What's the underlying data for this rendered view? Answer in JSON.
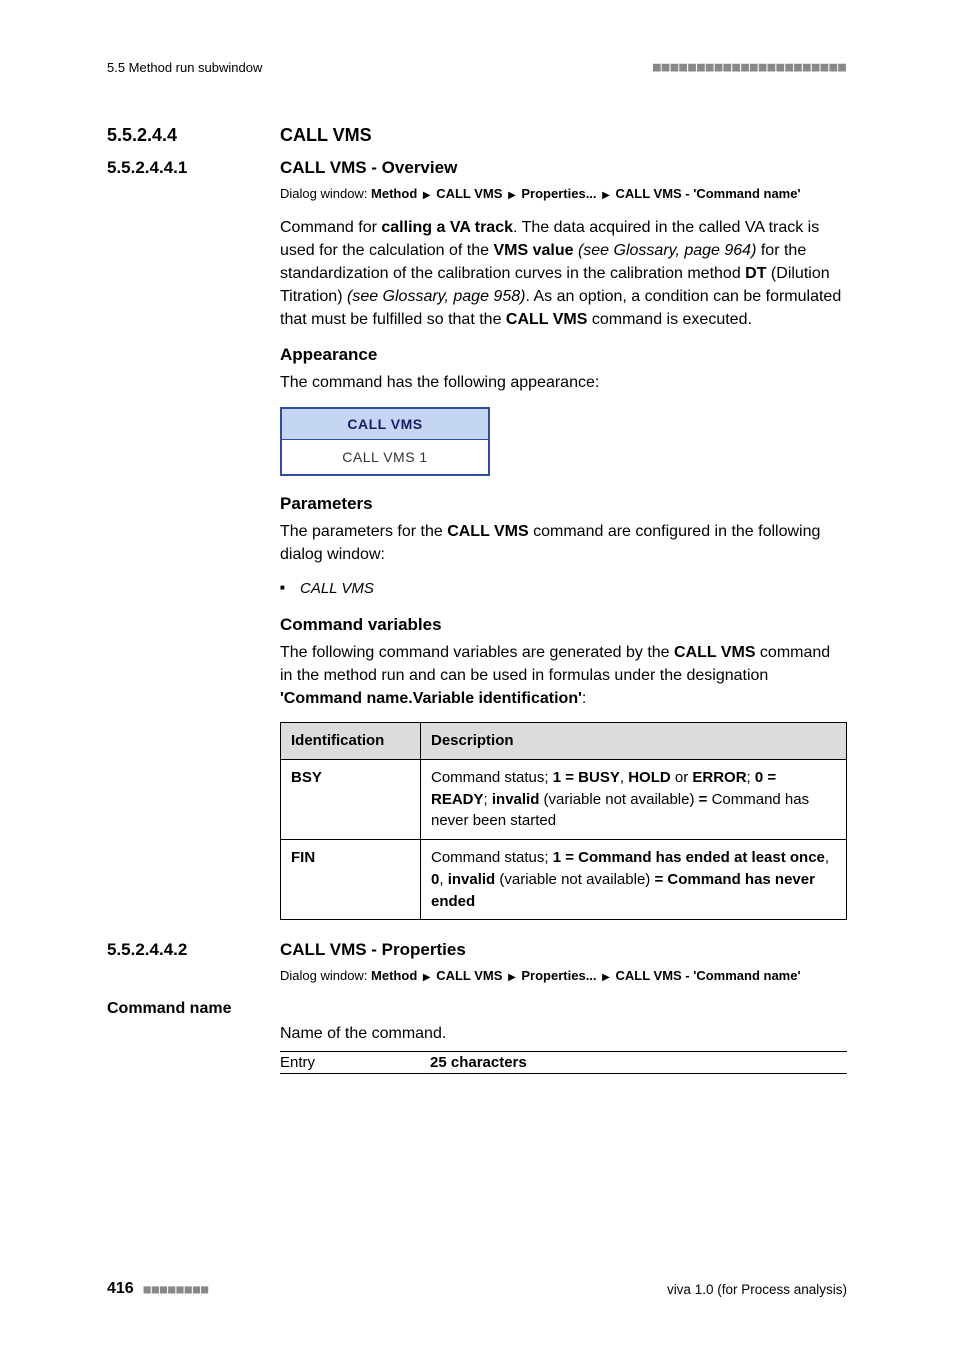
{
  "header": {
    "running_title": "5.5 Method run subwindow",
    "deco": "■■■■■■■■■■■■■■■■■■■■■■"
  },
  "sections": {
    "s0": {
      "num": "5.5.2.4.4",
      "title": "CALL VMS"
    },
    "s1": {
      "num": "5.5.2.4.4.1",
      "title": "CALL VMS - Overview",
      "dialog_label": "Dialog window: ",
      "dialog_parts": [
        "Method",
        "CALL VMS",
        "Properties...",
        "CALL VMS - 'Command name'"
      ],
      "para1_pre": "Command for ",
      "para1_b1": "calling a VA track",
      "para1_mid1": ". The data acquired in the called VA track is used for the calculation of the ",
      "para1_b2": "VMS value",
      "para1_i1": " (see Glossary, page 964)",
      "para1_mid2": " for the standardization of the calibration curves in the calibration method ",
      "para1_b3": "DT",
      "para1_mid3": " (Dilution Titration) ",
      "para1_i2": "(see Glossary, page 958)",
      "para1_mid4": ". As an option, a condition can be formulated that must be fulfilled so that the ",
      "para1_b4": "CALL VMS",
      "para1_end": " command is executed.",
      "appearance_head": "Appearance",
      "appearance_text": "The command has the following appearance:",
      "callvms_head": "CALL VMS",
      "callvms_body": "CALL VMS 1",
      "params_head": "Parameters",
      "params_pre": "The parameters for the ",
      "params_b": "CALL VMS",
      "params_post": " command are configured in the following dialog window:",
      "params_items": [
        "CALL VMS"
      ],
      "cmdvar_head": "Command variables",
      "cmdvar_pre": "The following command variables are generated by the ",
      "cmdvar_b": "CALL VMS",
      "cmdvar_mid": " command in the method run and can be used in formulas under the designation ",
      "cmdvar_b2": "'Command name.Variable identification'",
      "cmdvar_end": ":"
    },
    "table": {
      "col1": "Identification",
      "col2": "Description",
      "rows": [
        {
          "id": "BSY",
          "d_pre": "Command status; ",
          "d_b1": "1 = BUSY",
          "d_m1": ", ",
          "d_b2": "HOLD",
          "d_m2": " or ",
          "d_b3": "ERROR",
          "d_m3": "; ",
          "d_b4": "0 = READY",
          "d_m4": "; ",
          "d_b5": "invalid",
          "d_m5": " (variable not available) ",
          "d_b6": "=",
          "d_m6": " Command has never been started"
        },
        {
          "id": "FIN",
          "d_pre": "Command status; ",
          "d_b1": "1 = Command has ended at least once",
          "d_m1": ", ",
          "d_b2": "0",
          "d_m2": ", ",
          "d_b3": "invalid",
          "d_m3": " (variable not available) ",
          "d_b4": "= Command has never ended",
          "d_m4": "",
          "d_b5": "",
          "d_m5": "",
          "d_b6": "",
          "d_m6": ""
        }
      ]
    },
    "s2": {
      "num": "5.5.2.4.4.2",
      "title": "CALL VMS - Properties",
      "dialog_label": "Dialog window: ",
      "dialog_parts": [
        "Method",
        "CALL VMS",
        "Properties...",
        "CALL VMS - 'Command name'"
      ],
      "cmdname_label": "Command name",
      "cmdname_text": "Name of the command.",
      "entry_label": "Entry",
      "entry_value": "25 characters"
    }
  },
  "footer": {
    "page": "416",
    "deco": "■■■■■■■■",
    "doc": "viva 1.0 (for Process analysis)"
  }
}
